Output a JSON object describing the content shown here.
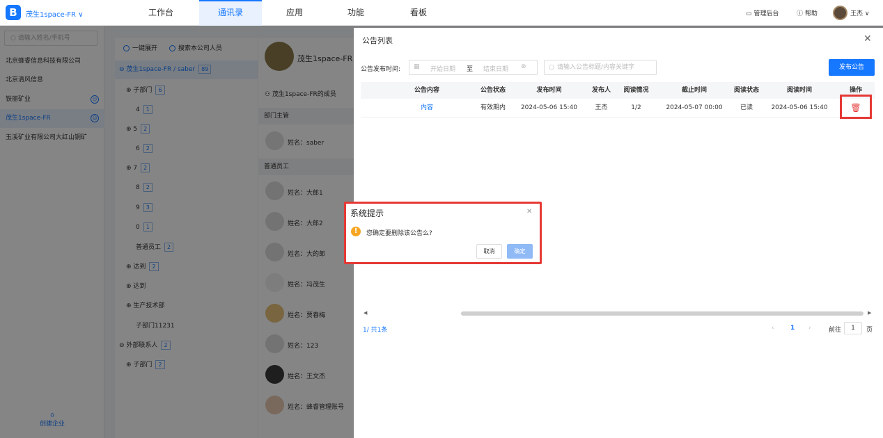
{
  "topbar": {
    "company": "茂生1space-FR",
    "nav": [
      "工作台",
      "通讯录",
      "应用",
      "功能",
      "看板"
    ],
    "admin": "管理后台",
    "help": "帮助",
    "user": "王杰"
  },
  "sidebar": {
    "search_placeholder": "请输入姓名/手机号",
    "companies": [
      "北京蜂睿信息科技有限公司",
      "北京清风信息",
      "铁丽矿业",
      "茂生1space-FR",
      "玉溪矿业有限公司大红山铜矿"
    ],
    "create": "创建企业"
  },
  "tree": {
    "expand": "一键展开",
    "search_company": "搜索本公司人员",
    "root": "茂生1space-FR / saber",
    "root_count": "89",
    "items": [
      {
        "label": "子部门",
        "count": "6"
      },
      {
        "label": "4",
        "count": "1"
      },
      {
        "label": "5",
        "count": "2"
      },
      {
        "label": "6",
        "count": "2"
      },
      {
        "label": "7",
        "count": "2"
      },
      {
        "label": "8",
        "count": "2"
      },
      {
        "label": "9",
        "count": "3"
      },
      {
        "label": "0",
        "count": "1"
      },
      {
        "label": "普通员工",
        "count": "2"
      },
      {
        "label": "达到",
        "count": "2"
      },
      {
        "label": "达到",
        "count": ""
      },
      {
        "label": "生产技术部",
        "count": ""
      },
      {
        "label": "子部门11231",
        "count": ""
      },
      {
        "label": "外部联系人",
        "count": "2"
      },
      {
        "label": "子部门",
        "count": "2"
      }
    ]
  },
  "members": {
    "org_name": "茂生1space-FR",
    "members_of": "茂生1space-FR的成员",
    "dept_head": "部门主管",
    "regular": "普通员工",
    "head": "姓名：saber",
    "list": [
      "姓名：大郎1",
      "姓名：大郎2",
      "姓名：大的郎",
      "姓名：冯茂生",
      "姓名：贾春梅",
      "姓名：123",
      "姓名：王文杰",
      "姓名：蜂睿管理账号"
    ]
  },
  "panel": {
    "title": "公告列表",
    "filter_label": "公告发布时间:",
    "start_date": "开始日期",
    "to": "至",
    "end_date": "结束日期",
    "search_placeholder": "请输入公告标题/内容关键字",
    "publish": "发布公告",
    "headers": [
      "公告内容",
      "公告状态",
      "发布时间",
      "发布人",
      "阅读情况",
      "截止时间",
      "阅读状态",
      "阅读时间",
      "操作"
    ],
    "row": [
      "内容",
      "有效期内",
      "2024-05-06 15:40",
      "王杰",
      "1/2",
      "2024-05-07 00:00",
      "已读",
      "2024-05-06 15:40"
    ],
    "page_info": "1/ 共1条",
    "page_current": "1",
    "goto": "前往",
    "goto_value": "1",
    "page_unit": "页"
  },
  "dialog": {
    "title": "系统提示",
    "message": "您确定要删除该公告么?",
    "cancel": "取消",
    "confirm": "确定"
  }
}
